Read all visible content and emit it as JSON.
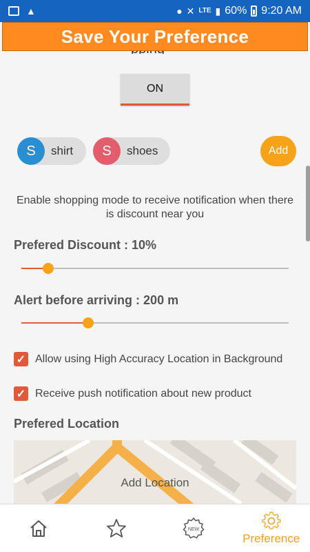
{
  "status_bar": {
    "network": "LTE",
    "battery": "60%",
    "time": "9:20 AM"
  },
  "header": {
    "title": "Save Your Preference"
  },
  "clipped_heading": "pping",
  "shopping_mode": {
    "toggle_label": "ON"
  },
  "chips": [
    {
      "initial": "S",
      "label": "shirt",
      "color": "#2a8fd0"
    },
    {
      "initial": "S",
      "label": "shoes",
      "color": "#e35e6c"
    }
  ],
  "add_button_label": "Add",
  "description": "Enable shopping mode to receive notification when there is discount near you",
  "discount": {
    "label": "Prefered Discount : 10%",
    "value_fraction": 0.1
  },
  "alert": {
    "label": "Alert before arriving : 200 m",
    "value_fraction": 0.25
  },
  "checkboxes": [
    {
      "label": "Allow using High Accuracy Location in Background",
      "checked": true
    },
    {
      "label": "Receive push notification about new product",
      "checked": true
    }
  ],
  "location": {
    "title": "Prefered Location",
    "map_label": "Add Location"
  },
  "bottom_nav": [
    {
      "icon": "home-icon",
      "label": ""
    },
    {
      "icon": "star-icon",
      "label": ""
    },
    {
      "icon": "new-badge-icon",
      "label": "",
      "badge_text": "NEW"
    },
    {
      "icon": "gear-icon",
      "label": "Preference",
      "active": true
    }
  ],
  "colors": {
    "status_bar": "#1565c0",
    "header": "#ff8a1f",
    "accent": "#f6a31a",
    "checkbox": "#e05a3a"
  }
}
